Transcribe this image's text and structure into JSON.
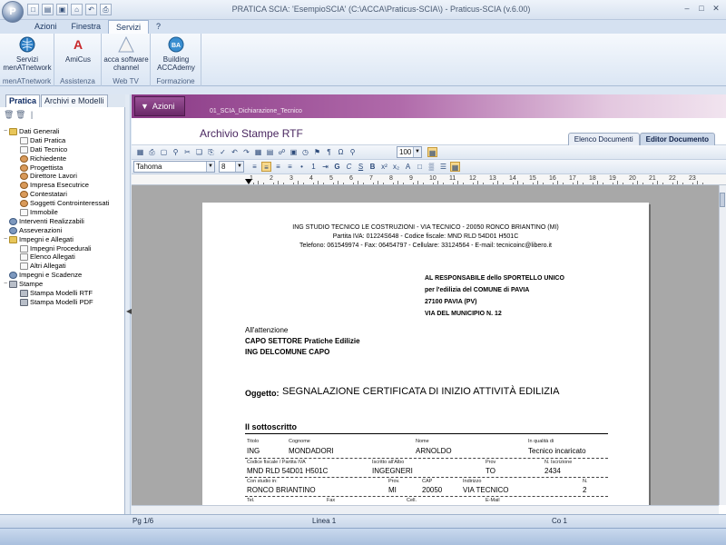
{
  "window": {
    "title": "PRATICA SCIA: 'EsempioSCIA'   (C:\\ACCA\\Praticus-SCIA\\) - Praticus-SCIA (v.6.00)",
    "qat_icons": [
      "new-icon",
      "open-icon",
      "save-icon",
      "home-icon",
      "undo-icon",
      "print-icon"
    ]
  },
  "ribbon": {
    "tabs": [
      "Azioni",
      "Finestra",
      "Servizi",
      "?"
    ],
    "active_tab": "Servizi",
    "groups": [
      {
        "label": "menATnetwork",
        "buttons": [
          {
            "label": "Servizi menATnetwork"
          }
        ]
      },
      {
        "label": "Assistenza",
        "buttons": [
          {
            "label": "AmiCus"
          }
        ]
      },
      {
        "label": "Web TV",
        "buttons": [
          {
            "label": "acca software channel"
          }
        ]
      },
      {
        "label": "Formazione",
        "buttons": [
          {
            "label": "Building ACCAdemy"
          }
        ]
      }
    ]
  },
  "left_panel": {
    "tabs": [
      "Pratica",
      "Archivi e Modelli"
    ],
    "active_tab": "Pratica",
    "tree": [
      {
        "label": "Dati Generali",
        "level": 0,
        "icon": "folder",
        "toggle": "−"
      },
      {
        "label": "Dati Pratica",
        "level": 1,
        "icon": "doc"
      },
      {
        "label": "Dati Tecnico",
        "level": 1,
        "icon": "doc"
      },
      {
        "label": "Richiedente",
        "level": 1,
        "icon": "user"
      },
      {
        "label": "Progettista",
        "level": 1,
        "icon": "user"
      },
      {
        "label": "Direttore Lavori",
        "level": 1,
        "icon": "user"
      },
      {
        "label": "Impresa Esecutrice",
        "level": 1,
        "icon": "user"
      },
      {
        "label": "Contestatari",
        "level": 1,
        "icon": "user"
      },
      {
        "label": "Soggetti Controinteressati",
        "level": 1,
        "icon": "user"
      },
      {
        "label": "Immobile",
        "level": 1,
        "icon": "doc"
      },
      {
        "label": "Interventi Realizzabili",
        "level": 0,
        "icon": "gear",
        "toggle": ""
      },
      {
        "label": "Asseverazioni",
        "level": 0,
        "icon": "gear",
        "toggle": ""
      },
      {
        "label": "Impegni e Allegati",
        "level": 0,
        "icon": "folder",
        "toggle": "−"
      },
      {
        "label": "Impegni Procedurali",
        "level": 1,
        "icon": "doc"
      },
      {
        "label": "Elenco Allegati",
        "level": 1,
        "icon": "doc"
      },
      {
        "label": "Altri Allegati",
        "level": 1,
        "icon": "doc"
      },
      {
        "label": "Impegni e Scadenze",
        "level": 0,
        "icon": "gear",
        "toggle": ""
      },
      {
        "label": "Stampe",
        "level": 0,
        "icon": "print",
        "toggle": "−"
      },
      {
        "label": "Stampa Modelli RTF",
        "level": 1,
        "icon": "print"
      },
      {
        "label": "Stampa Modelli PDF",
        "level": 1,
        "icon": "print"
      }
    ]
  },
  "main": {
    "azioni_label": "Azioni",
    "path": "01_SCIA_Dichiarazione_Tecnico",
    "archive_title": "Archivio Stampe RTF",
    "doc_tabs": [
      "Elenco Documenti",
      "Editor Documento"
    ],
    "active_doc_tab": "Editor Documento"
  },
  "editor": {
    "zoom": "100",
    "font": "Tahoma",
    "font_size": "8",
    "ruler_numbers": [
      "1",
      "2",
      "3",
      "4",
      "5",
      "6",
      "7",
      "8",
      "9",
      "10",
      "11",
      "12",
      "13",
      "14",
      "15",
      "16",
      "17",
      "18",
      "19",
      "20",
      "21",
      "22",
      "23"
    ]
  },
  "letter": {
    "head1": "ING STUDIO TECNICO LE COSTRUZIONI - VIA TECNICO - 20050 RONCO BRIANTINO (MI)",
    "head2": "Partita IVA: 01224S648 - Codice fiscale: MND RLD 54D01 H501C",
    "head3": "Telefono: 061549974 - Fax: 06454797 - Cellulare: 33124564 - E-mail: tecnicoinc@libero.it",
    "addr1": "AL RESPONSABILE dello SPORTELLO UNICO",
    "addr2": "per l'edilizia del COMUNE di PAVIA",
    "addr3": "27100 PAVIA (PV)",
    "addr4": "VIA DEL MUNICIPIO N. 12",
    "att1": "All'attenzione",
    "att2": "CAPO SETTORE Pratiche Edilizie",
    "att3": "ING  DELCOMUNE  CAPO",
    "oggetto_label": "Oggetto:",
    "oggetto_text": "SEGNALAZIONE CERTIFICATA DI INIZIO ATTIVITÀ EDILIZIA",
    "sottoscritto": "Il sottoscritto",
    "table": {
      "row1_labels": [
        "Titolo",
        "Cognome",
        "Nome",
        "In qualità di"
      ],
      "row1_values": [
        "ING",
        "MONDADORI",
        "ARNOLDO",
        "Tecnico incaricato"
      ],
      "row2_labels": [
        "Codice fiscale / Partita IVA",
        "Iscritto all'Albo",
        "Prov",
        "N. Iscrizione"
      ],
      "row2_values": [
        "MND RLD 54D01 H501C",
        "INGEGNERI",
        "TO",
        "2434"
      ],
      "row3_labels": [
        "Con studio in:",
        "Prov.",
        "CAP",
        "Indirizzo",
        "N."
      ],
      "row3_values": [
        "RONCO BRIANTINO",
        "MI",
        "20050",
        "VIA TECNICO",
        "2"
      ],
      "row4_labels": [
        "Tel.",
        "Fax",
        "Cell.",
        "E-Mail"
      ]
    }
  },
  "status": {
    "page": "Pg 1/6",
    "line": "Linea 1",
    "col": "Co 1"
  }
}
